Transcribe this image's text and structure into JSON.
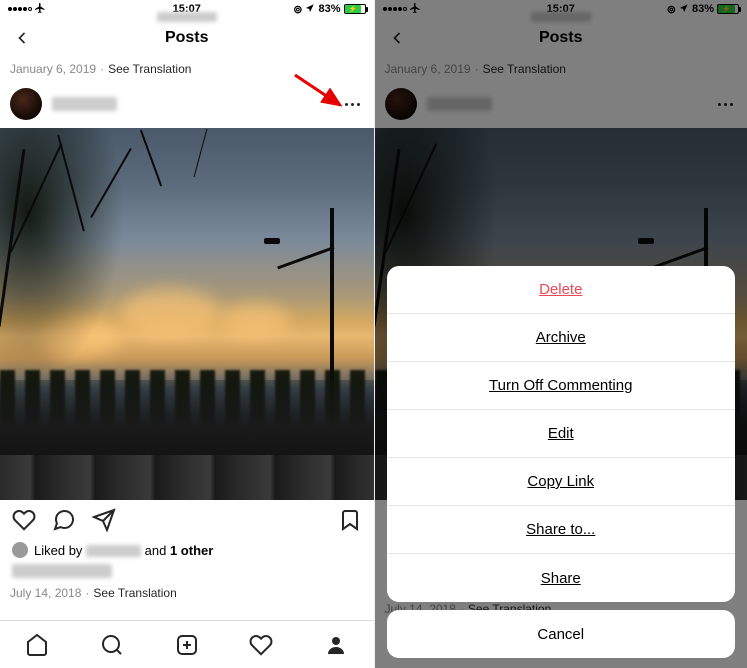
{
  "status": {
    "time": "15:07",
    "battery_percent": "83%"
  },
  "header": {
    "title": "Posts"
  },
  "post_meta": {
    "date_top": "January 6, 2019",
    "date_bottom": "July 14, 2018",
    "separator": "·",
    "translate": "See Translation"
  },
  "likes": {
    "prefix": "Liked by ",
    "suffix": " and ",
    "others": "1 other"
  },
  "sheet": {
    "delete": "Delete",
    "archive": "Archive",
    "turn_off": "Turn Off Commenting",
    "edit": "Edit",
    "copy_link": "Copy Link",
    "share_to": "Share to...",
    "share": "Share",
    "cancel": "Cancel"
  }
}
